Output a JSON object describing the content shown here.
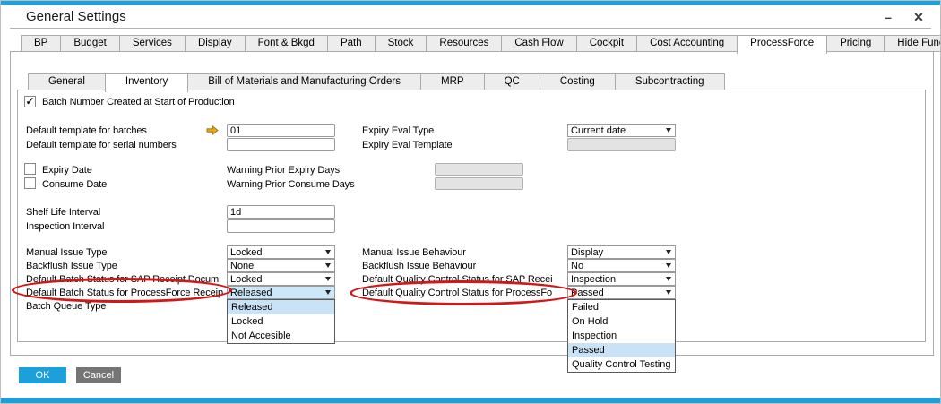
{
  "window": {
    "title": "General Settings"
  },
  "window_controls": {
    "minimize": "–",
    "close": "✕"
  },
  "colors": {
    "accent": "#1CA0DC",
    "ok_button": "#1CA0DC",
    "cancel_button": "#757575",
    "selection_highlight": "#C9E2F6",
    "combo_highlight": "#CDE7FA",
    "annotation_red": "#D01818"
  },
  "icons": {
    "link_arrow": "link-arrow-icon",
    "combo_arrow": "chevron-down-icon",
    "checkmark": "✓"
  },
  "outer_tabs": {
    "selected": "ProcessForce",
    "items": [
      {
        "label": "BP",
        "hotkey": 1
      },
      {
        "label": "Budget",
        "hotkey": 1
      },
      {
        "label": "Services",
        "hotkey": 2
      },
      {
        "label": "Display",
        "hotkey": null
      },
      {
        "label": "Font & Bkgd",
        "hotkey": 2
      },
      {
        "label": "Path",
        "hotkey": 1
      },
      {
        "label": "Stock",
        "hotkey": 0
      },
      {
        "label": "Resources",
        "hotkey": null
      },
      {
        "label": "Cash Flow",
        "hotkey": 0
      },
      {
        "label": "Cockpit",
        "hotkey": 3
      },
      {
        "label": "Cost Accounting",
        "hotkey": null
      },
      {
        "label": "ProcessForce",
        "hotkey": null
      },
      {
        "label": "Pricing",
        "hotkey": null
      },
      {
        "label": "Hide Functions",
        "hotkey": null
      }
    ]
  },
  "inner_tabs": {
    "selected": "Inventory",
    "items": [
      {
        "label": "General",
        "hotkey": null
      },
      {
        "label": "Inventory",
        "hotkey": null
      },
      {
        "label": "Bill of Materials and Manufacturing Orders",
        "hotkey": null
      },
      {
        "label": "MRP",
        "hotkey": null
      },
      {
        "label": "QC",
        "hotkey": null
      },
      {
        "label": "Costing",
        "hotkey": null
      },
      {
        "label": "Subcontracting",
        "hotkey": null
      }
    ]
  },
  "form": {
    "batch_number_created": {
      "label": "Batch Number Created at Start of Production",
      "checked": true
    },
    "default_template_batches": {
      "label": "Default template for batches",
      "value": "01"
    },
    "default_template_serial": {
      "label": "Default template for serial numbers",
      "value": ""
    },
    "expiry_eval_type": {
      "label": "Expiry Eval Type",
      "value": "Current date"
    },
    "expiry_eval_template": {
      "label": "Expiry Eval Template",
      "value": "",
      "disabled": true
    },
    "expiry_date": {
      "label": "Expiry Date",
      "checked": false
    },
    "consume_date": {
      "label": "Consume Date",
      "checked": false
    },
    "warning_prior_expiry_days": {
      "label": "Warning Prior Expiry Days",
      "value": "",
      "disabled": true
    },
    "warning_prior_consume_days": {
      "label": "Warning Prior Consume Days",
      "value": "",
      "disabled": true
    },
    "shelf_life_interval": {
      "label": "Shelf Life Interval",
      "value": "1d"
    },
    "inspection_interval": {
      "label": "Inspection Interval",
      "value": ""
    },
    "manual_issue_type": {
      "label": "Manual Issue Type",
      "value": "Locked"
    },
    "backflush_issue_type": {
      "label": "Backflush Issue Type",
      "value": "None"
    },
    "default_batch_status_sap_receipt": {
      "label": "Default Batch Status for SAP Receipt Docum",
      "value": "Locked"
    },
    "default_batch_status_processforce_receipt": {
      "label": "Default Batch Status for ProcessForce Receip",
      "value": "Released"
    },
    "batch_queue_type": {
      "label": "Batch Queue Type"
    },
    "manual_issue_behaviour": {
      "label": "Manual Issue Behaviour",
      "value": "Display"
    },
    "backflush_issue_behaviour": {
      "label": "Backflush Issue Behaviour",
      "value": "No"
    },
    "default_qc_status_sap_receipt": {
      "label": "Default Quality Control Status for SAP Recei",
      "value": "Inspection"
    },
    "default_qc_status_processforce": {
      "label": "Default Quality Control Status for ProcessFo",
      "value": "Passed"
    }
  },
  "open_dropdowns": {
    "batch_status": {
      "selected_index": 0,
      "items": [
        "Released",
        "Locked",
        "Not Accesible"
      ]
    },
    "qc_status": {
      "selected_index": 3,
      "items": [
        "Failed",
        "On Hold",
        "Inspection",
        "Passed",
        "Quality Control Testing"
      ]
    }
  },
  "buttons": {
    "ok": "OK",
    "cancel": "Cancel"
  }
}
